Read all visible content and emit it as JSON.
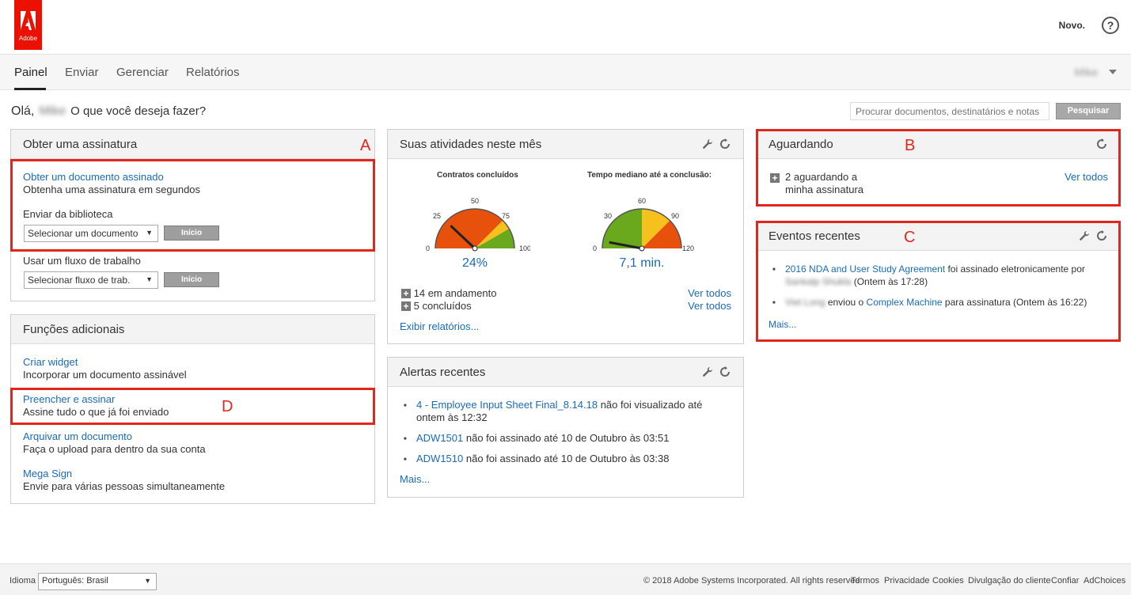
{
  "header": {
    "logo_text": "Adobe",
    "new_label": "Novo.",
    "help_label": "?"
  },
  "nav": {
    "tabs": [
      "Painel",
      "Enviar",
      "Gerenciar",
      "Relatórios"
    ],
    "user_name": "Mike"
  },
  "greeting": {
    "hello": "Olá,",
    "name": "Mike",
    "question": "O que você deseja fazer?"
  },
  "search": {
    "placeholder": "Procurar documentos, destinatários e notas",
    "button": "Pesquisar"
  },
  "get_signature": {
    "title": "Obter uma assinatura",
    "marker": "A",
    "link": "Obter um documento assinado",
    "subtitle": "Obtenha uma assinatura em segundos",
    "library_label": "Enviar da biblioteca",
    "library_select": "Selecionar um documento",
    "start_button": "Início",
    "workflow_label": "Usar um fluxo de trabalho",
    "workflow_select": "Selecionar fluxo de trab.",
    "workflow_button": "Início"
  },
  "additional": {
    "title": "Funções adicionais",
    "marker": "D",
    "items": [
      {
        "link": "Criar widget",
        "desc": "Incorporar um documento assinável"
      },
      {
        "link": "Preencher e assinar",
        "desc": "Assine tudo o que já foi enviado"
      },
      {
        "link": "Arquivar um documento",
        "desc": "Faça o upload para dentro da sua conta"
      },
      {
        "link": "Mega Sign",
        "desc": "Envie para várias pessoas simultaneamente"
      }
    ]
  },
  "activities": {
    "title": "Suas atividades neste mês",
    "gauge1": {
      "label": "Contratos concluídos",
      "ticks": [
        "0",
        "25",
        "50",
        "75",
        "100"
      ],
      "value_text": "24%",
      "value": 24,
      "max": 100
    },
    "gauge2": {
      "label": "Tempo mediano até a conclusão:",
      "ticks": [
        "0",
        "30",
        "60",
        "90",
        "120"
      ],
      "value_text": "7,1 min.",
      "value": 7.1,
      "max": 120
    },
    "in_progress": "14 em andamento",
    "completed": "5 concluídos",
    "see_all": "Ver todos",
    "see_all_2": "Ver todos",
    "reports_link": "Exibir relatórios..."
  },
  "alerts": {
    "title": "Alertas recentes",
    "items": [
      {
        "link": "4 - Employee Input Sheet Final_8.14.18",
        "text": " não foi visualizado até ontem às 12:32"
      },
      {
        "link": "ADW1501",
        "text": " não foi assinado até 10 de Outubro às 03:51"
      },
      {
        "link": "ADW1510",
        "text": " não foi assinado até 10 de Outubro às 03:38"
      }
    ],
    "more": "Mais..."
  },
  "waiting": {
    "title": "Aguardando",
    "marker": "B",
    "text": "2 aguardando a minha assinatura",
    "see_all": "Ver todos"
  },
  "events": {
    "title": "Eventos recentes",
    "marker": "C",
    "item1_link": "2016 NDA and User Study Agreement",
    "item1_text": " foi assinado eletronicamente por",
    "item1_person": "Sankalp Shukla",
    "item1_time": " (Ontem às 17:28)",
    "item2_person": "Viet Long",
    "item2_text1": " enviou o ",
    "item2_link": "Complex Machine",
    "item2_text2": " para assinatura (Ontem às 16:22)",
    "more": "Mais..."
  },
  "footer": {
    "language_label": "Idioma",
    "language_value": "Português: Brasil",
    "copyright": "© 2018 Adobe Systems Incorporated. All rights reserved.",
    "links": [
      "Termos",
      "Privacidade",
      "Cookies",
      "Divulgação do cliente",
      "Confiar",
      "AdChoices"
    ]
  },
  "colors": {
    "accent_red": "#e1261c",
    "link_blue": "#1a6bb8",
    "adobe_red": "#eb1000",
    "gauge_green": "#6aa81d",
    "gauge_yellow": "#f7c11d",
    "gauge_orange": "#e8510c"
  }
}
